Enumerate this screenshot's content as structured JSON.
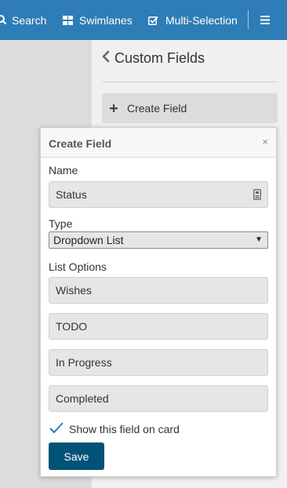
{
  "topbar": {
    "search_label": "Search",
    "swimlanes_label": "Swimlanes",
    "multiselection_label": "Multi-Selection",
    "bg_color": "#2e7db6"
  },
  "sidebar": {
    "title": "Custom Fields",
    "create_field_label": "Create Field"
  },
  "popup": {
    "title": "Create Field",
    "close": "×",
    "name_label": "Name",
    "name_value": "Status",
    "type_label": "Type",
    "type_value": "Dropdown List",
    "list_options_label": "List Options",
    "options": [
      "Wishes",
      "TODO",
      "In Progress",
      "Completed"
    ],
    "show_on_card_label": "Show this field on card",
    "show_on_card_checked": true,
    "save_label": "Save",
    "save_color": "#005377"
  },
  "icons": {
    "search": "search-icon",
    "swimlanes": "swimlanes-icon",
    "multiselection": "checkbox-icon",
    "menu": "hamburger-icon",
    "back": "chevron-left-icon",
    "plus": "plus-icon",
    "field_type": "field-type-icon",
    "check": "checkmark-icon"
  }
}
